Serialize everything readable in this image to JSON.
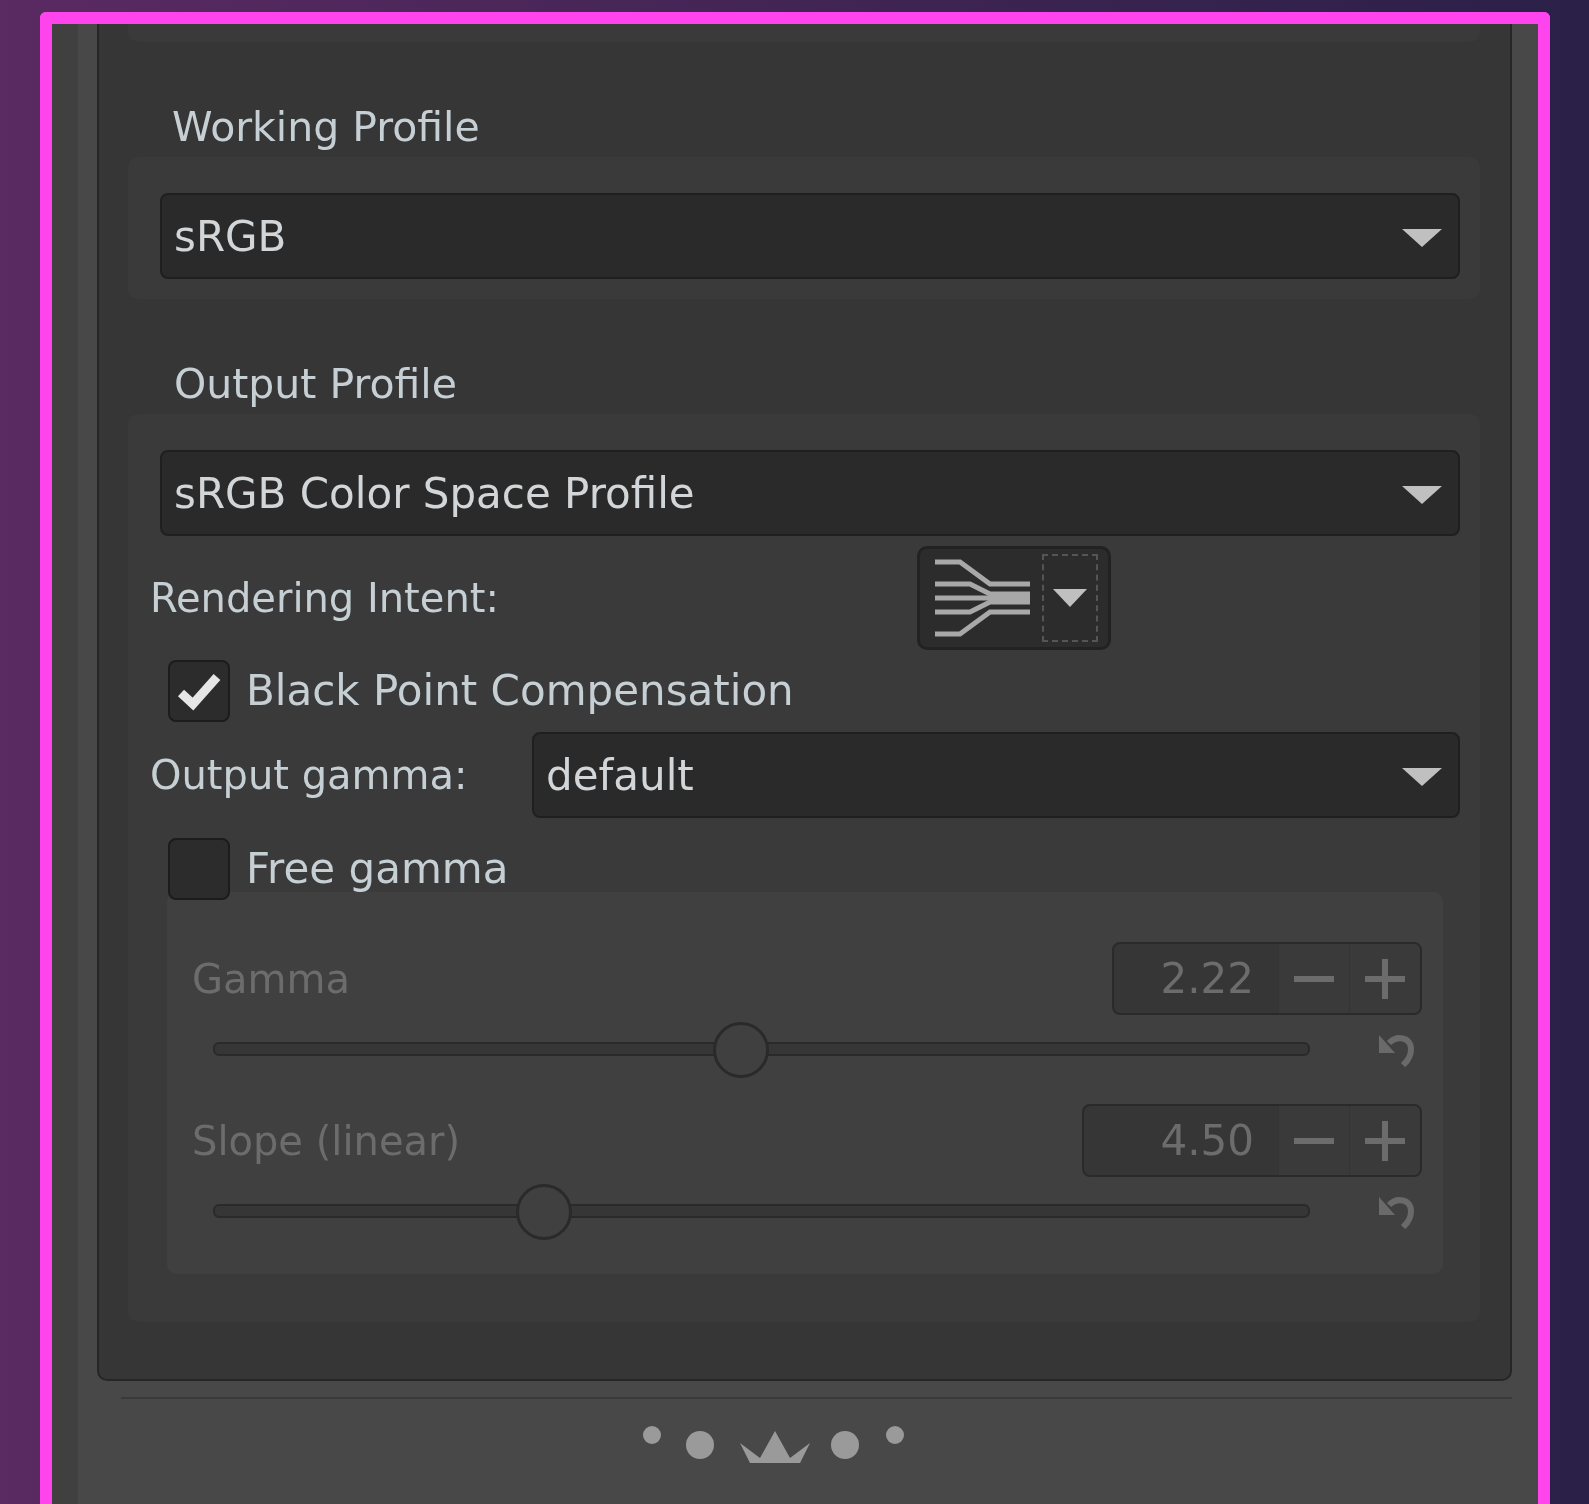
{
  "working_profile": {
    "title": "Working Profile",
    "value": "sRGB"
  },
  "output_profile": {
    "title": "Output Profile",
    "value": "sRGB Color Space Profile",
    "rendering_intent": {
      "label": "Rendering Intent:"
    },
    "black_point_compensation": {
      "label": "Black Point Compensation",
      "checked": true
    },
    "output_gamma": {
      "label": "Output gamma:",
      "value": "default"
    },
    "free_gamma": {
      "label": "Free gamma",
      "checked": false
    },
    "sliders": [
      {
        "label": "Gamma",
        "value": "2.22",
        "level": 0.48
      },
      {
        "label": "Slope (linear)",
        "value": "4.50",
        "level": 0.3
      }
    ]
  }
}
